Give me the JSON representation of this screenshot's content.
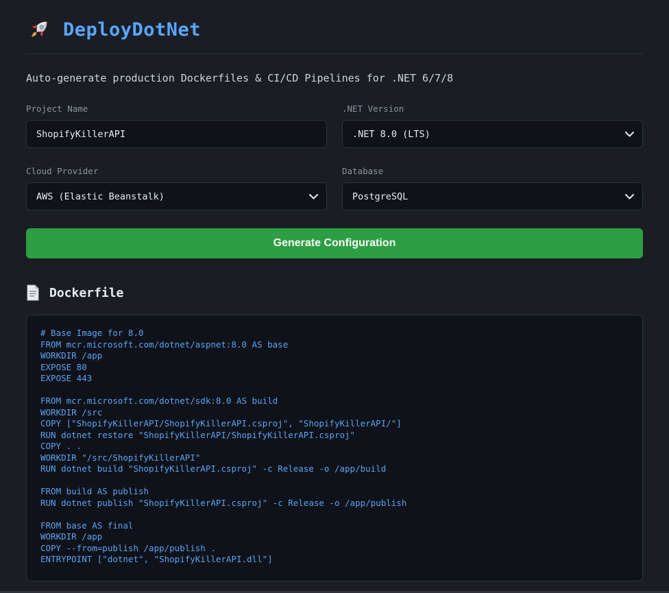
{
  "app": {
    "title": "DeployDotNet",
    "subtitle": "Auto-generate production Dockerfiles & CI/CD Pipelines for .NET 6/7/8"
  },
  "form": {
    "project_name": {
      "label": "Project Name",
      "value": "ShopifyKillerAPI"
    },
    "dotnet_version": {
      "label": ".NET Version",
      "selected": ".NET 8.0 (LTS)"
    },
    "cloud_provider": {
      "label": "Cloud Provider",
      "selected": "AWS (Elastic Beanstalk)"
    },
    "database": {
      "label": "Database",
      "selected": "PostgreSQL"
    },
    "generate_button_label": "Generate Configuration"
  },
  "output": {
    "heading": "Dockerfile",
    "dockerfile": "# Base Image for 8.0\nFROM mcr.microsoft.com/dotnet/aspnet:8.0 AS base\nWORKDIR /app\nEXPOSE 80\nEXPOSE 443\n\nFROM mcr.microsoft.com/dotnet/sdk:8.0 AS build\nWORKDIR /src\nCOPY [\"ShopifyKillerAPI/ShopifyKillerAPI.csproj\", \"ShopifyKillerAPI/\"]\nRUN dotnet restore \"ShopifyKillerAPI/ShopifyKillerAPI.csproj\"\nCOPY . .\nWORKDIR \"/src/ShopifyKillerAPI\"\nRUN dotnet build \"ShopifyKillerAPI.csproj\" -c Release -o /app/build\n\nFROM build AS publish\nRUN dotnet publish \"ShopifyKillerAPI.csproj\" -c Release -o /app/publish\n\nFROM base AS final\nWORKDIR /app\nCOPY --from=publish /app/publish .\nENTRYPOINT [\"dotnet\", \"ShopifyKillerAPI.dll\"]"
  },
  "icons": {
    "logo": "rocket-icon",
    "output_section": "document-icon",
    "dropdown": "chevron-down-icon"
  },
  "colors": {
    "accent_blue": "#58a6ff",
    "button_green": "#2e9e44",
    "code_text_blue": "#5ba3f5",
    "background": "#1a1d24",
    "field_background": "#0f1218",
    "border": "#2d333b",
    "label_gray": "#8b949e"
  }
}
